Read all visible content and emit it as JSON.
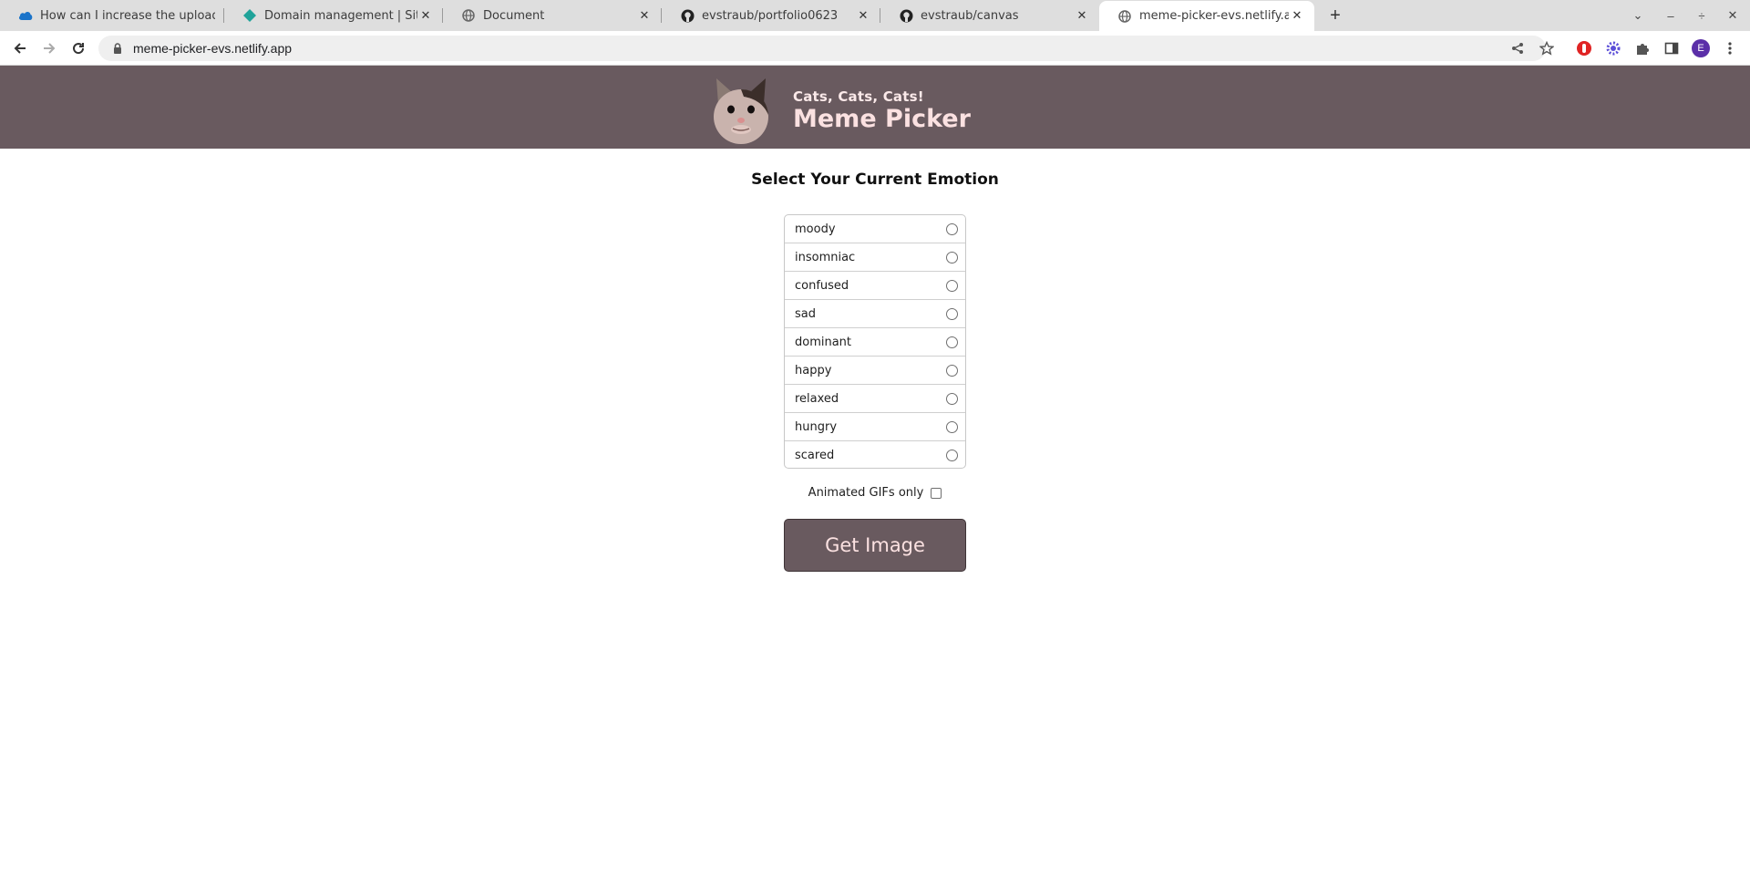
{
  "browser": {
    "tabs": [
      {
        "title": "How can I increase the upload l",
        "favicon": "onedrive-icon"
      },
      {
        "title": "Domain management | Site co",
        "favicon": "netlify-icon"
      },
      {
        "title": "Document",
        "favicon": "globe-icon"
      },
      {
        "title": "evstraub/portfolio0623",
        "favicon": "github-icon"
      },
      {
        "title": "evstraub/canvas",
        "favicon": "github-icon"
      },
      {
        "title": "meme-picker-evs.netlify.app",
        "favicon": "globe-icon",
        "active": true
      }
    ],
    "url": "meme-picker-evs.netlify.app",
    "profile_initial": "E"
  },
  "header": {
    "subtitle": "Cats, Cats, Cats!",
    "title": "Meme Picker"
  },
  "main": {
    "heading": "Select Your Current Emotion",
    "emotions": [
      "moody",
      "insomniac",
      "confused",
      "sad",
      "dominant",
      "happy",
      "relaxed",
      "hungry",
      "scared"
    ],
    "gif_label": "Animated GIFs only",
    "button_label": "Get Image"
  },
  "colors": {
    "header_bg": "#695a5f",
    "header_text": "#fbe1e1",
    "button_bg": "#695a5f"
  }
}
